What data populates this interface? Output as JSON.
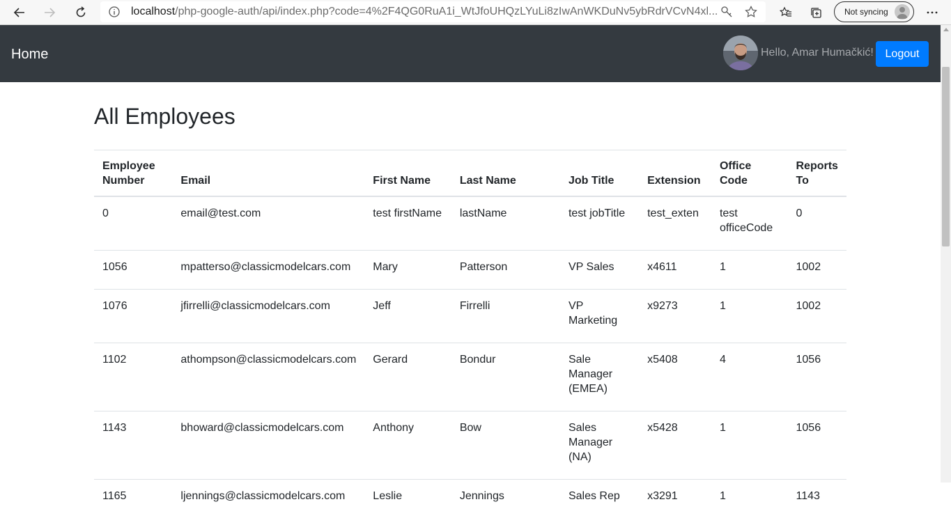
{
  "browser": {
    "url_host": "localhost",
    "url_path": "/php-google-auth/api/index.php?code=4%2F4QG0RuA1i_WtJfoUHQzLYuLi8zIwAnWKDuNv5ybRdrVCvN4xl...",
    "profile_label": "Not syncing"
  },
  "navbar": {
    "brand": "Home",
    "greeting": "Hello, Amar Humačkić!",
    "logout_label": "Logout"
  },
  "page": {
    "title": "All Employees"
  },
  "table": {
    "headers": {
      "employee_number": "Employee Number",
      "email": "Email",
      "first_name": "First Name",
      "last_name": "Last Name",
      "job_title": "Job Title",
      "extension": "Extension",
      "office_code": "Office Code",
      "reports_to": "Reports To"
    },
    "rows": [
      {
        "number": "0",
        "email": "email@test.com",
        "first": "test firstName",
        "last": "lastName",
        "job": "test jobTitle",
        "ext": "test_exten",
        "office": "test officeCode",
        "reports": "0"
      },
      {
        "number": "1056",
        "email": "mpatterso@classicmodelcars.com",
        "first": "Mary",
        "last": "Patterson",
        "job": "VP Sales",
        "ext": "x4611",
        "office": "1",
        "reports": "1002"
      },
      {
        "number": "1076",
        "email": "jfirrelli@classicmodelcars.com",
        "first": "Jeff",
        "last": "Firrelli",
        "job": "VP Marketing",
        "ext": "x9273",
        "office": "1",
        "reports": "1002"
      },
      {
        "number": "1102",
        "email": "athompson@classicmodelcars.com",
        "first": "Gerard",
        "last": "Bondur",
        "job": "Sale Manager (EMEA)",
        "ext": "x5408",
        "office": "4",
        "reports": "1056"
      },
      {
        "number": "1143",
        "email": "bhoward@classicmodelcars.com",
        "first": "Anthony",
        "last": "Bow",
        "job": "Sales Manager (NA)",
        "ext": "x5428",
        "office": "1",
        "reports": "1056"
      },
      {
        "number": "1165",
        "email": "ljennings@classicmodelcars.com",
        "first": "Leslie",
        "last": "Jennings",
        "job": "Sales Rep",
        "ext": "x3291",
        "office": "1",
        "reports": "1143"
      }
    ]
  },
  "icons": {
    "back": "back-arrow-icon",
    "forward": "forward-arrow-icon",
    "reload": "reload-icon",
    "info": "info-icon",
    "key": "key-icon",
    "favorite": "star-icon",
    "favorites_list": "favorites-icon",
    "collections": "collections-icon",
    "more": "more-icon"
  },
  "colors": {
    "navbar_bg": "#343a40",
    "primary": "#007bff"
  }
}
